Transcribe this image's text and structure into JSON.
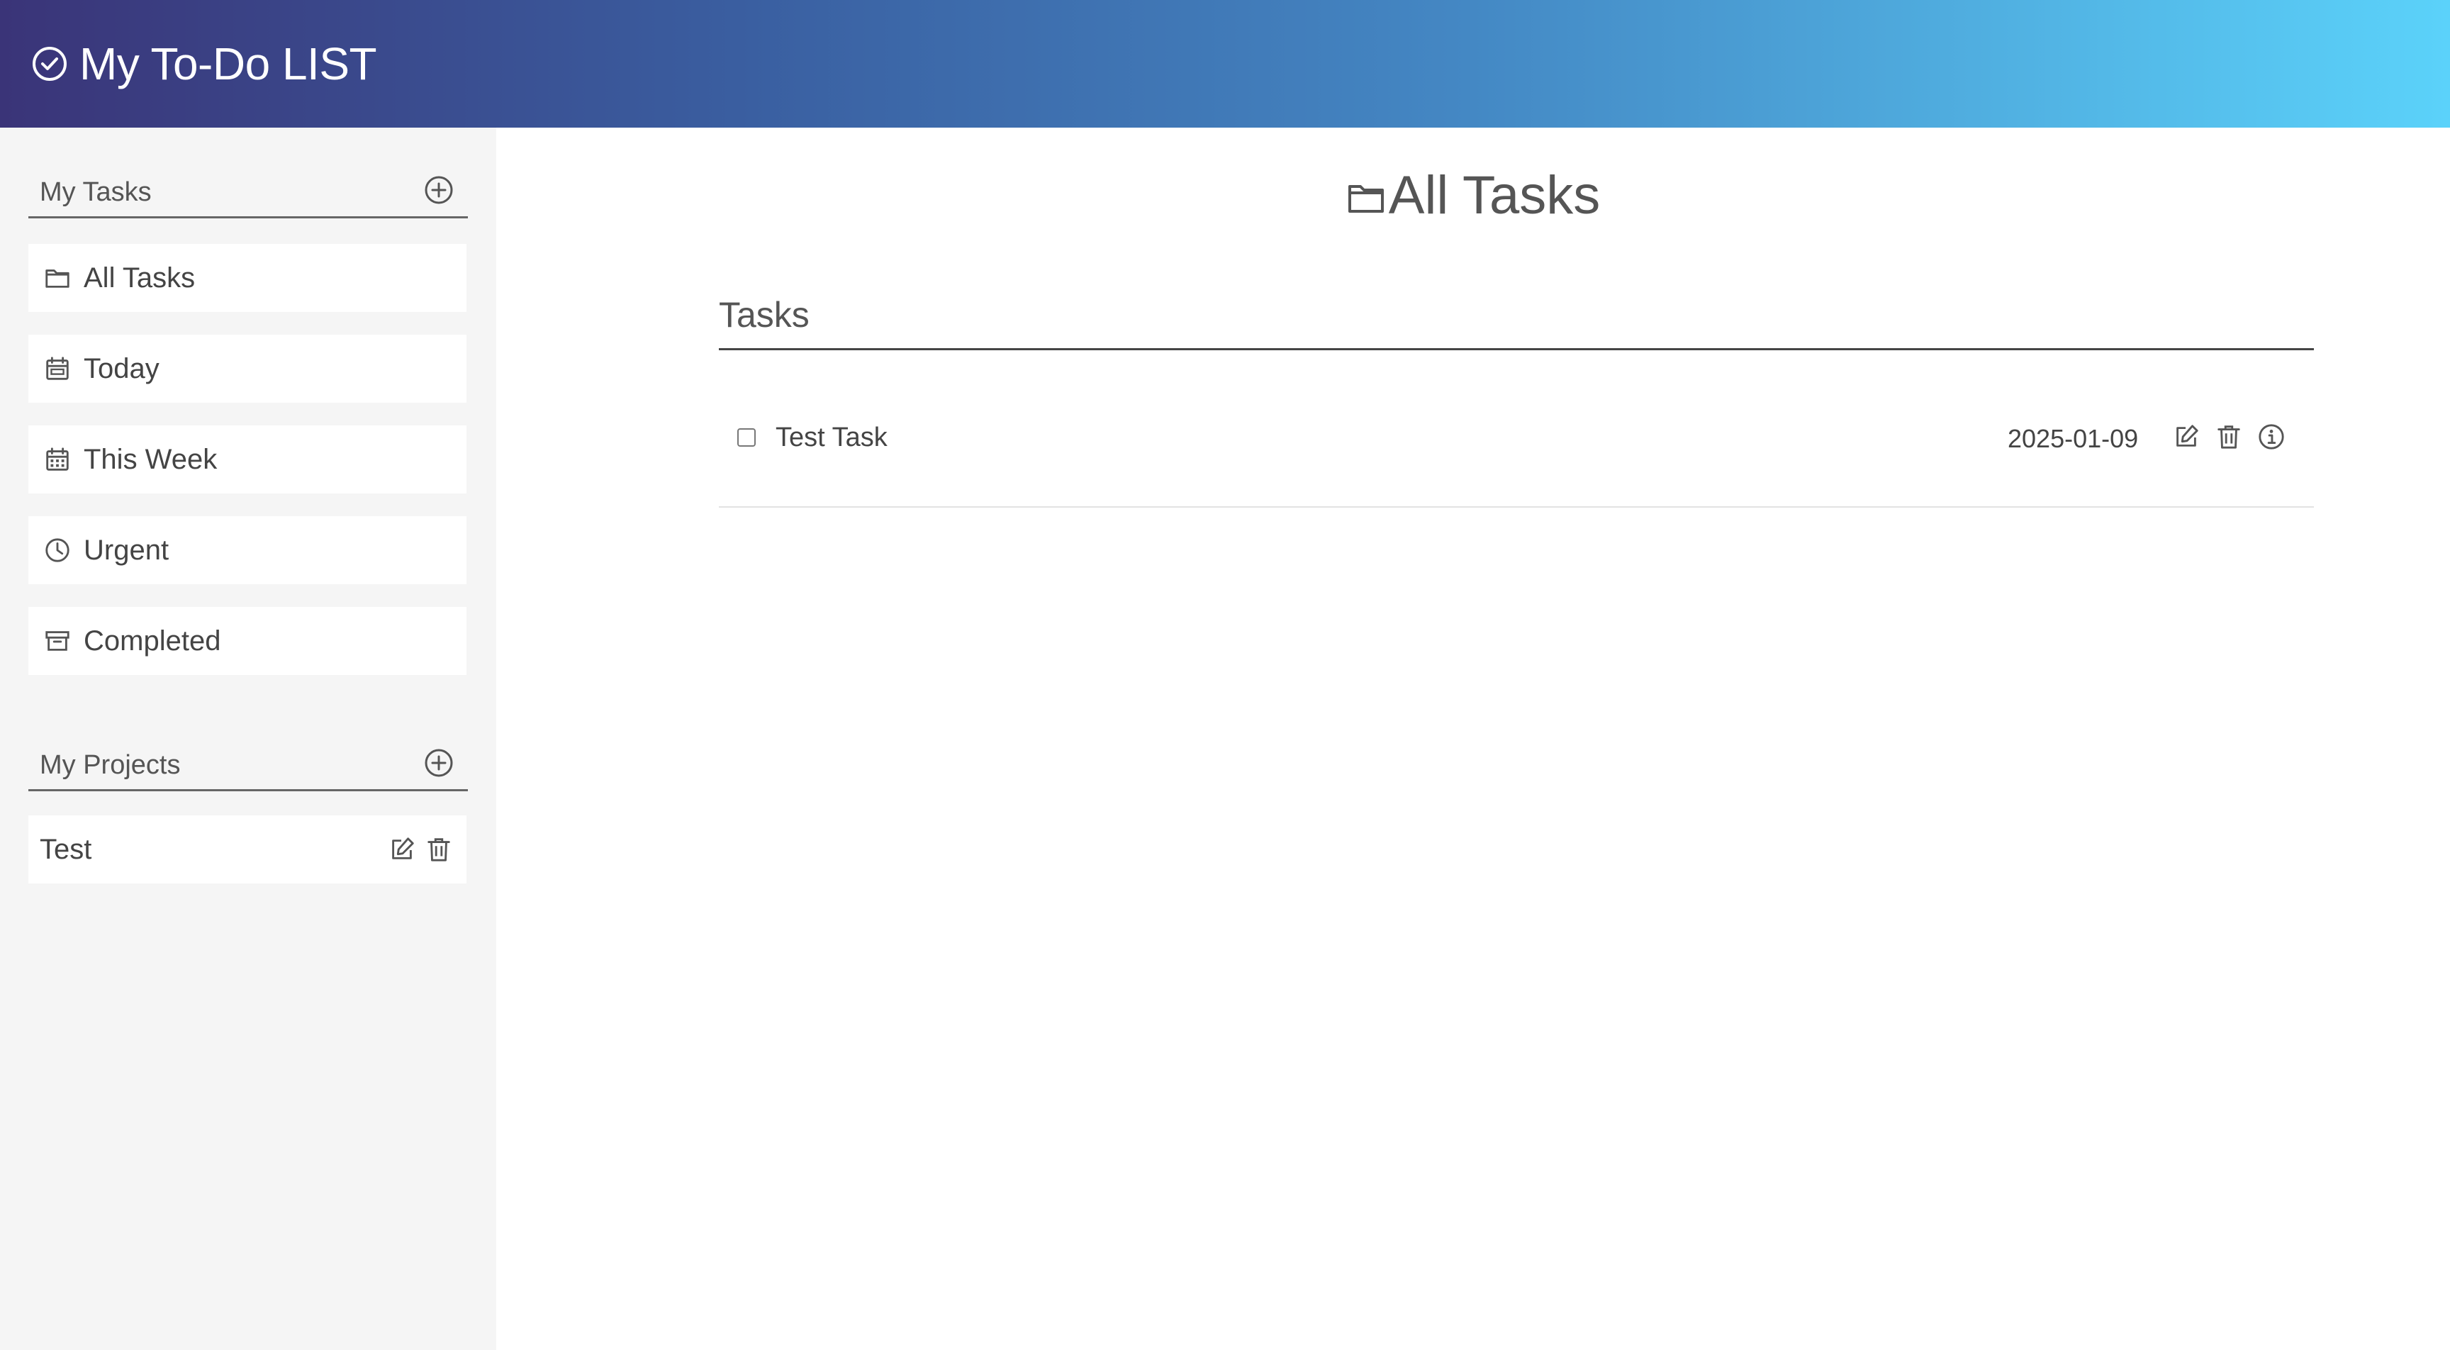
{
  "header": {
    "title": "My To-Do LIST",
    "logo_icon": "check-circle-icon"
  },
  "sidebar": {
    "tasks_section": {
      "label": "My Tasks",
      "add_icon": "plus-circle-icon"
    },
    "items": [
      {
        "label": "All Tasks",
        "icon": "folder-icon"
      },
      {
        "label": "Today",
        "icon": "calendar-icon"
      },
      {
        "label": "This Week",
        "icon": "calendar-week-icon"
      },
      {
        "label": "Urgent",
        "icon": "clock-icon"
      },
      {
        "label": "Completed",
        "icon": "archive-icon"
      }
    ],
    "projects_section": {
      "label": "My Projects",
      "add_icon": "plus-circle-icon"
    },
    "projects": [
      {
        "label": "Test",
        "edit_icon": "edit-icon",
        "delete_icon": "trash-icon"
      }
    ]
  },
  "main": {
    "heading": "All Tasks",
    "heading_icon": "folder-icon",
    "tasks_label": "Tasks",
    "tasks": [
      {
        "title": "Test Task",
        "due_date": "2025-01-09",
        "completed": false,
        "edit_icon": "edit-icon",
        "delete_icon": "trash-icon",
        "info_icon": "info-icon"
      }
    ]
  },
  "colors": {
    "header_gradient_start": "#3a3478",
    "header_gradient_end": "#5bd2fa",
    "sidebar_bg": "#f5f5f5",
    "text": "#444444"
  }
}
